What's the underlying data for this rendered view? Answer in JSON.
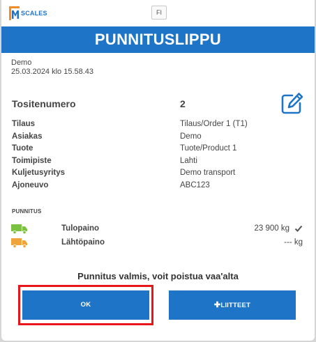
{
  "brand": {
    "logo_text": "SCALES"
  },
  "language": {
    "current": "FI"
  },
  "title": "PUNNITUSLIPPU",
  "meta": {
    "customer": "Demo",
    "datetime": "25.03.2024 klo 15.58.43"
  },
  "voucher": {
    "label": "Tositenumero",
    "value": "2",
    "edit_icon": "edit-icon"
  },
  "details": [
    {
      "label": "Tilaus",
      "value": "Tilaus/Order 1 (T1)"
    },
    {
      "label": "Asiakas",
      "value": "Demo"
    },
    {
      "label": "Tuote",
      "value": "Tuote/Product 1"
    },
    {
      "label": "Toimipiste",
      "value": "Lahti"
    },
    {
      "label": "Kuljetusyritys",
      "value": "Demo transport"
    },
    {
      "label": "Ajoneuvo",
      "value": "ABC123"
    }
  ],
  "weighing": {
    "section_label": "PUNNITUS",
    "rows": [
      {
        "label": "Tulopaino",
        "value": "23 900 kg",
        "truck_color": "#7cc242",
        "done": true
      },
      {
        "label": "Lähtöpaino",
        "value": "--- kg",
        "truck_color": "#f0a43c",
        "done": false
      }
    ]
  },
  "status": "Punnitus valmis, voit poistua vaa'alta",
  "buttons": {
    "ok": "OK",
    "attachments": "LIITTEET"
  },
  "colors": {
    "primary": "#1e74c6",
    "highlight": "#e8151b"
  }
}
